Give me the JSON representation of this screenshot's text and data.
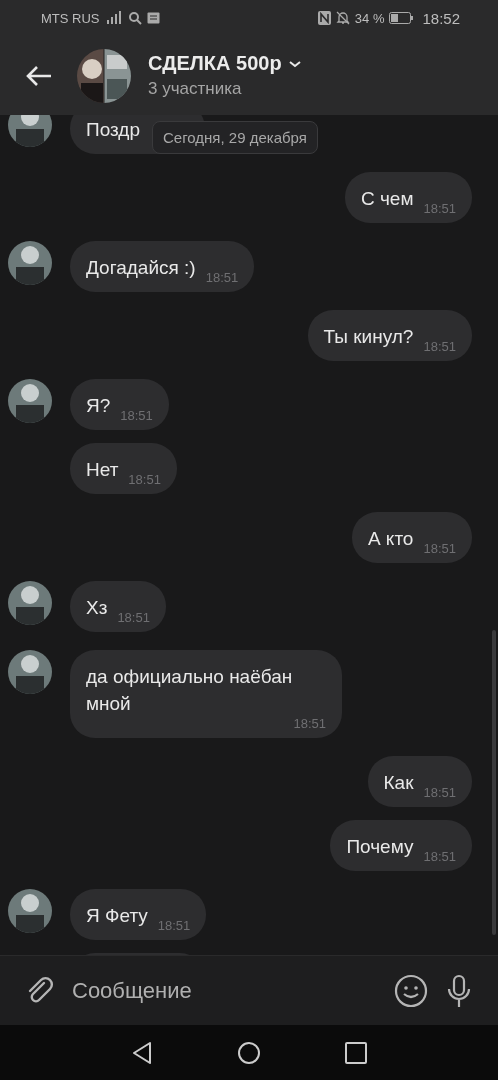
{
  "status_bar": {
    "carrier": "MTS RUS",
    "battery": "34 %",
    "time": "18:52"
  },
  "header": {
    "title": "СДЕЛКА 500р",
    "subtitle": "3 участника"
  },
  "date_chip": "Сегодня, 29 декабря",
  "messages": [
    {
      "kind": "incoming",
      "avatar": true,
      "text": "Поздр",
      "cut": true
    },
    {
      "kind": "outgoing",
      "avatar": false,
      "text": "С чем",
      "time": "18:51"
    },
    {
      "kind": "incoming",
      "avatar": true,
      "text": "Догадайся :)",
      "time": "18:51"
    },
    {
      "kind": "outgoing",
      "avatar": false,
      "text": "Ты кинул?",
      "time": "18:51"
    },
    {
      "kind": "incoming",
      "avatar": true,
      "text": "Я?",
      "time": "18:51"
    },
    {
      "kind": "incoming",
      "avatar": false,
      "text": "Нет",
      "time": "18:51"
    },
    {
      "kind": "outgoing",
      "avatar": false,
      "text": "А кто",
      "time": "18:51"
    },
    {
      "kind": "incoming",
      "avatar": true,
      "text": "Хз",
      "time": "18:51"
    },
    {
      "kind": "incoming",
      "avatar": true,
      "text": "да официально наёбан мной",
      "time": "18:51"
    },
    {
      "kind": "outgoing",
      "avatar": false,
      "text": "Как",
      "time": "18:51"
    },
    {
      "kind": "outgoing",
      "avatar": false,
      "text": "Почему",
      "time": "18:51"
    },
    {
      "kind": "incoming",
      "avatar": true,
      "text": "Я Фету",
      "time": "18:51"
    },
    {
      "kind": "incoming",
      "avatar": false,
      "cut": true
    }
  ],
  "composer": {
    "placeholder": "Сообщение"
  }
}
